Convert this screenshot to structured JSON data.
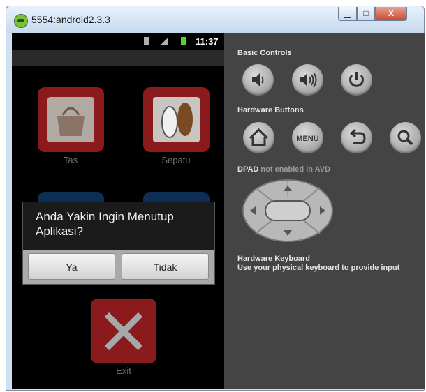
{
  "window": {
    "title": "5554:android2.3.3",
    "minimize_glyph": "▁",
    "maximize_glyph": "□",
    "close_glyph": "X",
    "app_icon": "android-icon"
  },
  "status_bar": {
    "time": "11:37",
    "icons": [
      "usb-icon",
      "signal-icon",
      "battery-icon"
    ]
  },
  "app": {
    "tiles": [
      {
        "label": "Tas",
        "icon": "bag-icon"
      },
      {
        "label": "Sepatu",
        "icon": "shoe-icon"
      }
    ],
    "exit_label": "Exit",
    "colors": {
      "tile": "#8a1a1c",
      "tile_blue": "#0d2f55",
      "exit_x": "#a8a8a8"
    }
  },
  "dialog": {
    "message": "Anda Yakin Ingin Menutup Aplikasi?",
    "yes_label": "Ya",
    "no_label": "Tidak"
  },
  "controls": {
    "basic_title": "Basic Controls",
    "basic_buttons": [
      "volume-down-icon",
      "volume-up-icon",
      "power-icon"
    ],
    "hardware_title": "Hardware Buttons",
    "hardware_buttons": [
      "home-icon",
      "menu-button",
      "back-icon",
      "search-icon"
    ],
    "menu_label": "MENU",
    "dpad_title": "DPAD",
    "dpad_note": "not enabled in AVD",
    "keyboard_title": "Hardware Keyboard",
    "keyboard_hint": "Use your physical keyboard to provide input"
  }
}
